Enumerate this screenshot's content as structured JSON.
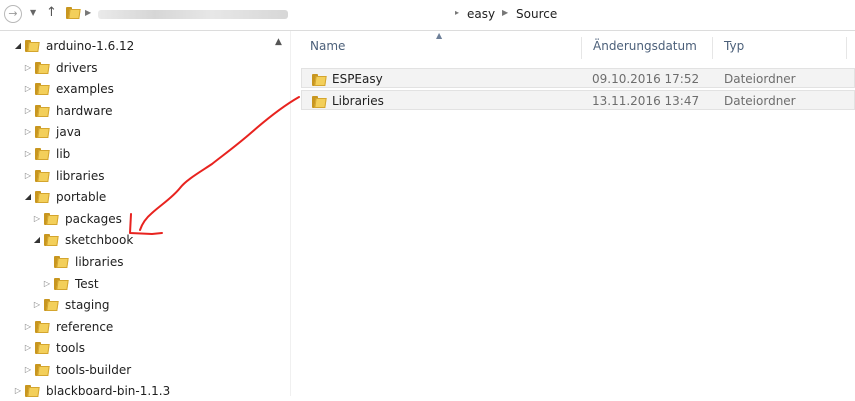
{
  "address_bar": {
    "crumbs": [
      "easy",
      "Source"
    ],
    "icons": [
      "back-arrow-icon",
      "dropdown-chevron-icon",
      "up-arrow-icon",
      "folder-icon"
    ]
  },
  "tree": {
    "items": [
      {
        "label": "arduino-1.6.12",
        "expanded": true
      },
      {
        "label": "drivers",
        "expanded": false
      },
      {
        "label": "examples",
        "expanded": false
      },
      {
        "label": "hardware",
        "expanded": false
      },
      {
        "label": "java",
        "expanded": false
      },
      {
        "label": "lib",
        "expanded": false
      },
      {
        "label": "libraries",
        "expanded": false
      },
      {
        "label": "portable",
        "expanded": true
      },
      {
        "label": "packages",
        "expanded": false
      },
      {
        "label": "sketchbook",
        "expanded": true
      },
      {
        "label": "libraries",
        "expanded": null
      },
      {
        "label": "Test",
        "expanded": false
      },
      {
        "label": "staging",
        "expanded": false
      },
      {
        "label": "reference",
        "expanded": false
      },
      {
        "label": "tools",
        "expanded": false
      },
      {
        "label": "tools-builder",
        "expanded": false
      },
      {
        "label": "blackboard-bin-1.1.3",
        "expanded": false
      }
    ]
  },
  "file_list": {
    "columns": [
      "Name",
      "Änderungsdatum",
      "Typ"
    ],
    "rows": [
      {
        "name": "ESPEasy",
        "date": "09.10.2016 17:52",
        "type": "Dateiordner"
      },
      {
        "name": "Libraries",
        "date": "13.11.2016 13:47",
        "type": "Dateiordner"
      }
    ]
  },
  "annotation": {
    "color": "#e8231f",
    "icon": "hand-drawn-arrow"
  },
  "colors": {
    "folder": "#f3cf5a",
    "header_text": "#4c607a",
    "selection": "#f3f3f3"
  }
}
